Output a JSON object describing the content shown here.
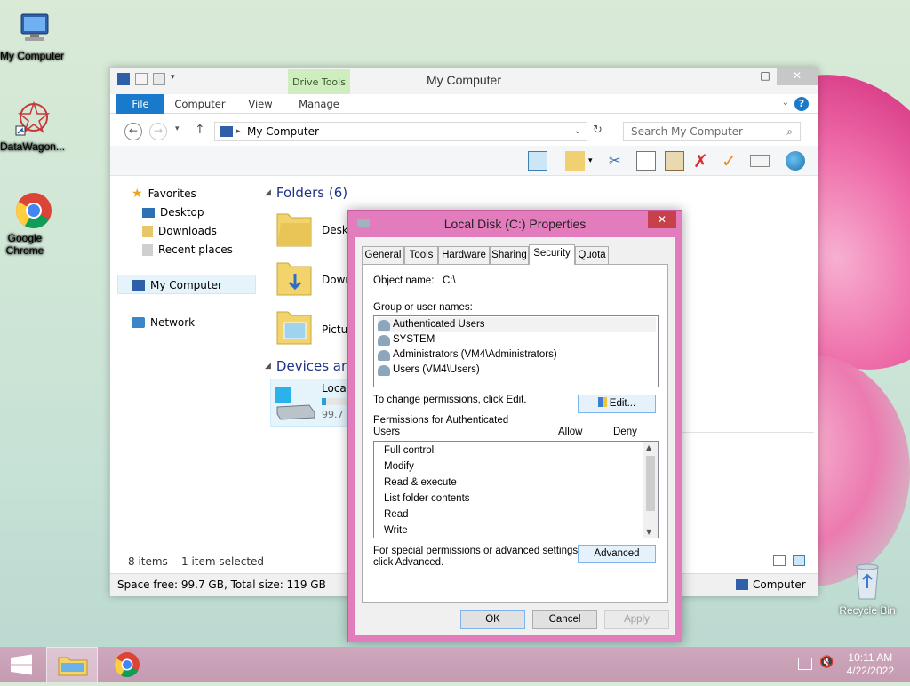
{
  "desktop": {
    "icons": [
      {
        "label": "My Computer"
      },
      {
        "label": "DataWagon..."
      },
      {
        "label": "Google Chrome"
      }
    ],
    "recycle_label": "Recycle Bin"
  },
  "explorer": {
    "title": "My Computer",
    "drive_tools": "Drive Tools",
    "tabs": [
      "File",
      "Computer",
      "View",
      "Manage"
    ],
    "address": "My Computer",
    "search_placeholder": "Search My Computer",
    "nav": {
      "favorites": "Favorites",
      "desktop": "Desktop",
      "downloads": "Downloads",
      "recent": "Recent places",
      "mycomputer": "My Computer",
      "network": "Network"
    },
    "groups": {
      "folders": "Folders (6)",
      "devices": "Devices and"
    },
    "folders": [
      "Deskt",
      "Down",
      "Pictur"
    ],
    "drive": {
      "name": "Local",
      "free": "99.7",
      "usage_fraction": 0.16
    },
    "status_items": "8 items",
    "status_selected": "1 item selected",
    "status_space": "Space free: 99.7 GB, Total size: 119 GB",
    "status_computer": "Computer"
  },
  "dialog": {
    "title": "Local Disk (C:) Properties",
    "tabs": [
      "General",
      "Tools",
      "Hardware",
      "Sharing",
      "Security",
      "Quota"
    ],
    "active_tab": "Security",
    "object_name_label": "Object name:",
    "object_name_value": "C:\\",
    "group_label": "Group or user names:",
    "users": [
      "Authenticated Users",
      "SYSTEM",
      "Administrators (VM4\\Administrators)",
      "Users (VM4\\Users)"
    ],
    "change_text": "To change permissions, click Edit.",
    "edit_button": "Edit...",
    "perm_for_line1": "Permissions for Authenticated",
    "perm_for_line2": "Users",
    "allow_label": "Allow",
    "deny_label": "Deny",
    "permissions": [
      "Full control",
      "Modify",
      "Read & execute",
      "List folder contents",
      "Read",
      "Write"
    ],
    "special_line1": "For special permissions or advanced settings,",
    "special_line2": "click Advanced.",
    "advanced_button": "Advanced",
    "ok_button": "OK",
    "cancel_button": "Cancel",
    "apply_button": "Apply"
  },
  "taskbar": {
    "time": "10:11 AM",
    "date": "4/22/2022"
  },
  "colors": {
    "accent": "#1979ca",
    "dialog_frame": "#e27cbd",
    "drive_tools": "#cfeec0"
  }
}
